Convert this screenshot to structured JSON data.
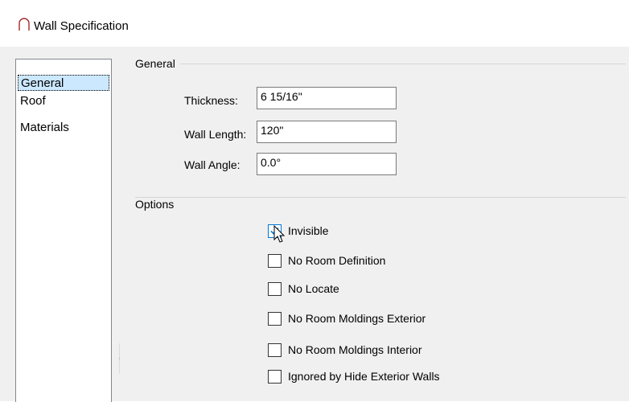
{
  "window": {
    "title": "Wall Specification",
    "icon": "wall-arc-icon"
  },
  "nav": {
    "items": [
      {
        "label": "General",
        "selected": true
      },
      {
        "label": "Roof",
        "selected": false
      },
      {
        "label": "Materials",
        "selected": false
      }
    ]
  },
  "general": {
    "group_label": "General",
    "fields": [
      {
        "label": "Thickness:",
        "value": "6 15/16\""
      },
      {
        "label": "Wall Length:",
        "value": "120\""
      },
      {
        "label": "Wall Angle:",
        "value": "0.0°"
      }
    ]
  },
  "options": {
    "group_label": "Options",
    "checkboxes": [
      {
        "label": "Invisible",
        "checked": true
      },
      {
        "label": "No Room Definition",
        "checked": false
      },
      {
        "label": "No Locate",
        "checked": false
      },
      {
        "label": "No Room Moldings Exterior",
        "checked": false
      },
      {
        "label": "No Room Moldings Interior",
        "checked": false
      },
      {
        "label": "Ignored by Hide Exterior Walls",
        "checked": false
      }
    ]
  },
  "colors": {
    "accent": "#0078d7",
    "selection": "#cce8ff",
    "background": "#f0f0f0"
  }
}
